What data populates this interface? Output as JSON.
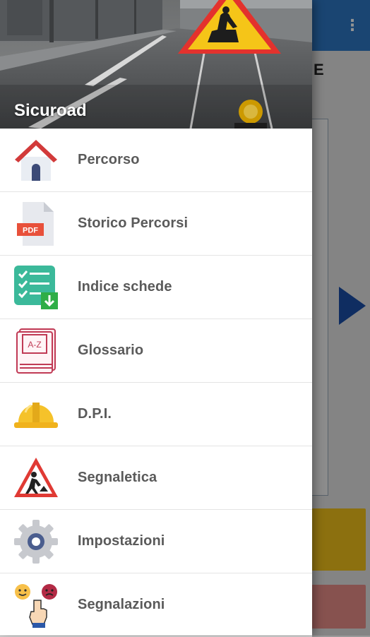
{
  "drawer": {
    "title": "Sicuroad",
    "items": [
      {
        "label": "Percorso",
        "icon": "home-icon"
      },
      {
        "label": "Storico Percorsi",
        "icon": "pdf-file-icon"
      },
      {
        "label": "Indice schede",
        "icon": "checklist-icon"
      },
      {
        "label": "Glossario",
        "icon": "glossary-book-icon"
      },
      {
        "label": "D.P.I.",
        "icon": "hard-hat-icon"
      },
      {
        "label": "Segnaletica",
        "icon": "roadwork-sign-icon"
      },
      {
        "label": "Impostazioni",
        "icon": "gear-icon"
      },
      {
        "label": "Segnalazioni",
        "icon": "feedback-icon"
      }
    ],
    "pdf_badge": "PDF",
    "glossary_badge": "A-Z"
  },
  "background": {
    "title_fragment": "E",
    "more_icon": "⋮"
  },
  "colors": {
    "toolbar": "#2d78c4",
    "accent_arrow": "#1b4fa8",
    "yellow_button": "#f2c21a",
    "red_button": "#e98e88"
  }
}
